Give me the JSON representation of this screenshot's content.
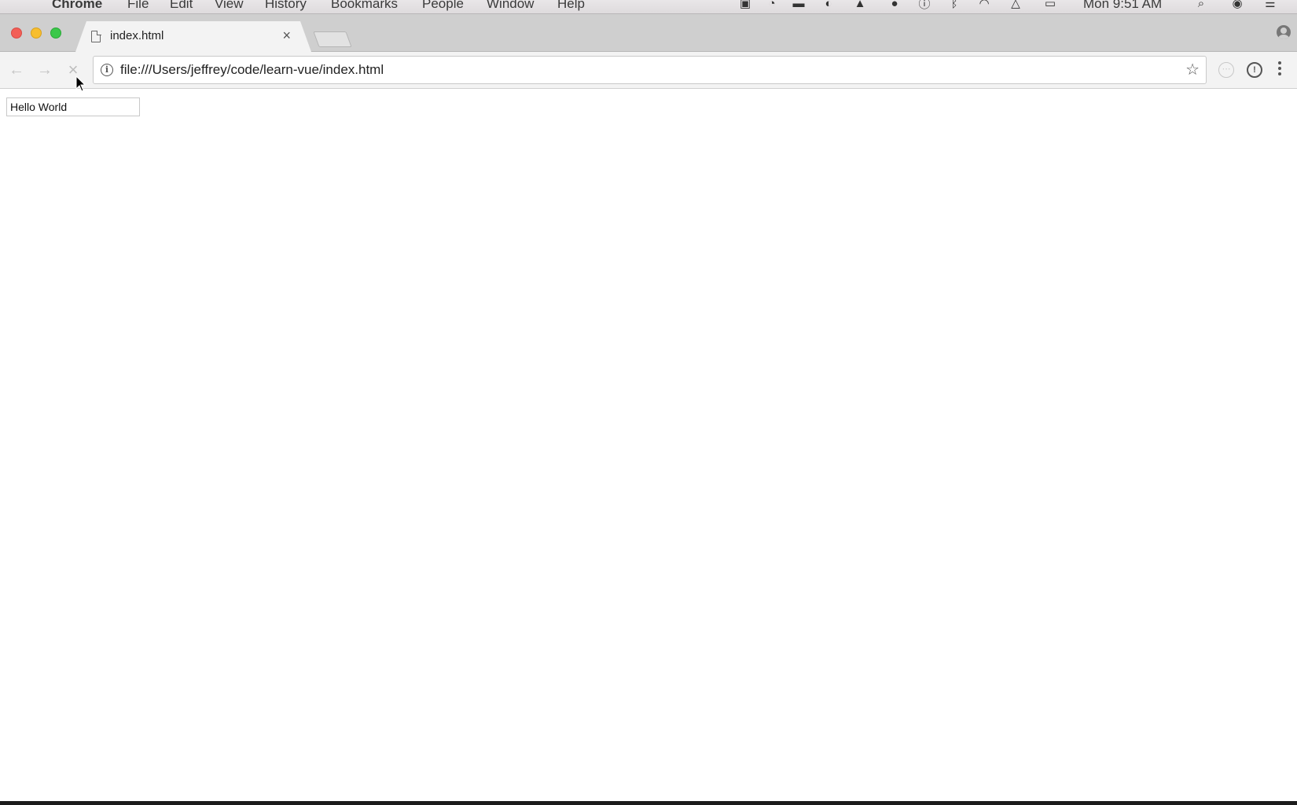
{
  "menubar": {
    "app_name": "Chrome",
    "items": [
      "File",
      "Edit",
      "View",
      "History",
      "Bookmarks",
      "People",
      "Window",
      "Help"
    ],
    "clock": "Mon 9:51 AM",
    "status_icons": [
      "screen-record-icon",
      "clock-icon",
      "battery-app-icon",
      "moon-icon",
      "hat-icon",
      "notification-icon",
      "info-icon",
      "bluetooth-icon",
      "wifi-icon",
      "airplay-icon",
      "battery-icon",
      "spotlight-search-icon",
      "siri-icon",
      "notification-center-icon"
    ]
  },
  "browser": {
    "tab": {
      "title": "index.html",
      "close_glyph": "×"
    },
    "toolbar": {
      "back_glyph": "←",
      "forward_glyph": "→",
      "stop_glyph": "×"
    },
    "omnibox": {
      "url": "file:///Users/jeffrey/code/learn-vue/index.html",
      "info_glyph": "i",
      "star_glyph": "☆"
    },
    "extensions": {
      "ext1_glyph": "⋯",
      "ext2_glyph": "!"
    }
  },
  "page": {
    "input_value": "Hello World"
  },
  "colors": {
    "close": "#f25f57",
    "minimize": "#f7be2f",
    "maximize": "#3bc84a"
  }
}
